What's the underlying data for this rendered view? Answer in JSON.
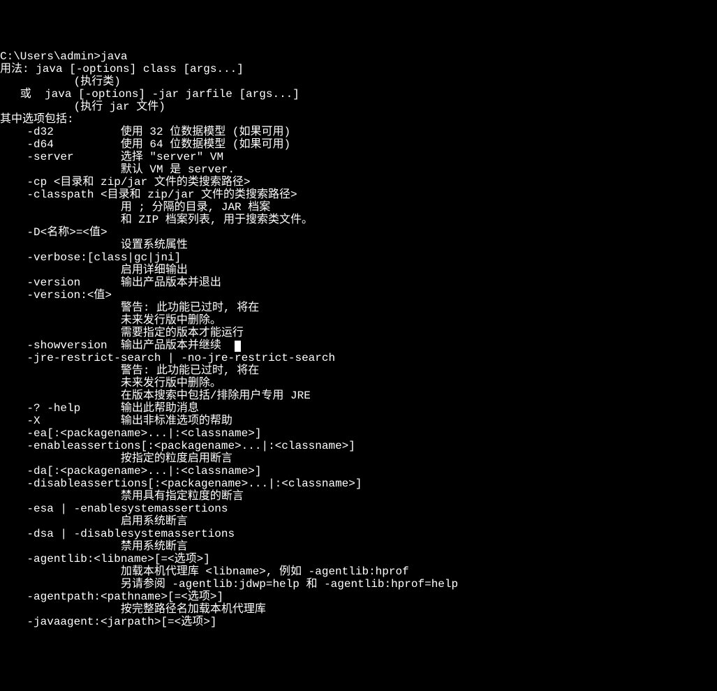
{
  "terminal": {
    "prompt": "C:\\Users\\admin>",
    "command": "java",
    "lines": [
      "用法: java [-options] class [args...]",
      "           (执行类)",
      "   或  java [-options] -jar jarfile [args...]",
      "           (执行 jar 文件)",
      "其中选项包括:",
      "    -d32          使用 32 位数据模型 (如果可用)",
      "    -d64          使用 64 位数据模型 (如果可用)",
      "    -server       选择 \"server\" VM",
      "                  默认 VM 是 server.",
      "",
      "    -cp <目录和 zip/jar 文件的类搜索路径>",
      "    -classpath <目录和 zip/jar 文件的类搜索路径>",
      "                  用 ; 分隔的目录, JAR 档案",
      "                  和 ZIP 档案列表, 用于搜索类文件。",
      "    -D<名称>=<值>",
      "                  设置系统属性",
      "    -verbose:[class|gc|jni]",
      "                  启用详细输出",
      "    -version      输出产品版本并退出",
      "    -version:<值>",
      "                  警告: 此功能已过时, 将在",
      "                  未来发行版中删除。",
      "                  需要指定的版本才能运行",
      "    -showversion  输出产品版本并继续",
      "    -jre-restrict-search | -no-jre-restrict-search",
      "                  警告: 此功能已过时, 将在",
      "                  未来发行版中删除。",
      "                  在版本搜索中包括/排除用户专用 JRE",
      "    -? -help      输出此帮助消息",
      "    -X            输出非标准选项的帮助",
      "    -ea[:<packagename>...|:<classname>]",
      "    -enableassertions[:<packagename>...|:<classname>]",
      "                  按指定的粒度启用断言",
      "    -da[:<packagename>...|:<classname>]",
      "    -disableassertions[:<packagename>...|:<classname>]",
      "                  禁用具有指定粒度的断言",
      "    -esa | -enablesystemassertions",
      "                  启用系统断言",
      "    -dsa | -disablesystemassertions",
      "                  禁用系统断言",
      "    -agentlib:<libname>[=<选项>]",
      "                  加载本机代理库 <libname>, 例如 -agentlib:hprof",
      "                  另请参阅 -agentlib:jdwp=help 和 -agentlib:hprof=help",
      "    -agentpath:<pathname>[=<选项>]",
      "                  按完整路径名加载本机代理库",
      "    -javaagent:<jarpath>[=<选项>]"
    ],
    "cursor_line_index": 23
  }
}
